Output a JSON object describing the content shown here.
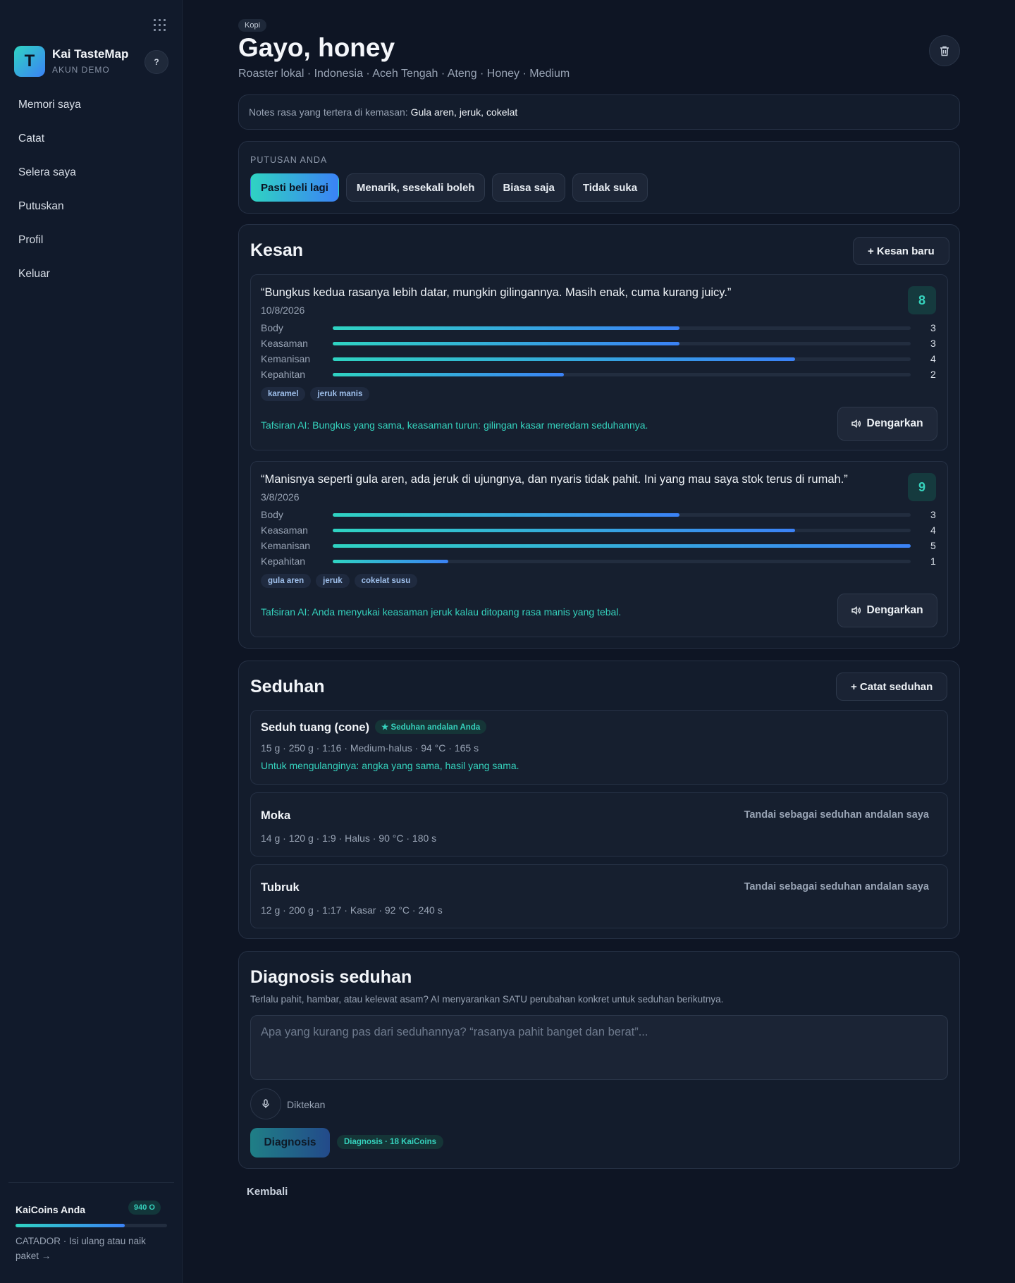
{
  "sidebar": {
    "brand_letter": "T",
    "brand_name": "Kai TasteMap",
    "brand_sub": "AKUN DEMO",
    "help_label": "?",
    "nav": [
      "Memori saya",
      "Catat",
      "Selera saya",
      "Putuskan",
      "Profil",
      "Keluar"
    ],
    "coins": {
      "title": "KaiCoins Anda",
      "badge": "940 O",
      "progress": 0.72,
      "note": "CATADOR · Isi ulang atau naik paket →"
    }
  },
  "header": {
    "chip": "Kopi",
    "title": "Gayo, honey",
    "meta": "Roaster lokal · Indonesia · Aceh Tengah · Ateng · Honey · Medium"
  },
  "notes": {
    "label": "Notes rasa yang tertera di kemasan:",
    "value": "Gula aren, jeruk, cokelat"
  },
  "decision": {
    "label": "PUTUSAN ANDA",
    "options": [
      "Pasti beli lagi",
      "Menarik, sesekali boleh",
      "Biasa saja",
      "Tidak suka"
    ],
    "selected": 0
  },
  "impressions": {
    "title": "Kesan",
    "add_label": "+ Kesan baru",
    "listen_label": "Dengarkan",
    "items": [
      {
        "quote": "“Bungkus kedua rasanya lebih datar, mungkin gilingannya. Masih enak, cuma kurang juicy.”",
        "date": "10/8/2026",
        "score": "8",
        "attributes": [
          {
            "label": "Body",
            "value": 3
          },
          {
            "label": "Keasaman",
            "value": 3
          },
          {
            "label": "Kemanisan",
            "value": 4
          },
          {
            "label": "Kepahitan",
            "value": 2
          }
        ],
        "tags": [
          "karamel",
          "jeruk manis"
        ],
        "ai": "Tafsiran AI: Bungkus yang sama, keasaman turun: gilingan kasar meredam seduhannya."
      },
      {
        "quote": "“Manisnya seperti gula aren, ada jeruk di ujungnya, dan nyaris tidak pahit. Ini yang mau saya stok terus di rumah.”",
        "date": "3/8/2026",
        "score": "9",
        "attributes": [
          {
            "label": "Body",
            "value": 3
          },
          {
            "label": "Keasaman",
            "value": 4
          },
          {
            "label": "Kemanisan",
            "value": 5
          },
          {
            "label": "Kepahitan",
            "value": 1
          }
        ],
        "tags": [
          "gula aren",
          "jeruk",
          "cokelat susu"
        ],
        "ai": "Tafsiran AI: Anda menyukai keasaman jeruk kalau ditopang rasa manis yang tebal."
      }
    ],
    "scale_max": 5
  },
  "brews": {
    "title": "Seduhan",
    "add_label": "+ Catat seduhan",
    "mark_label": "Tandai sebagai seduhan andalan saya",
    "items": [
      {
        "name": "Seduh tuang (cone)",
        "badge": "★ Seduhan andalan Anda",
        "params": "15 g · 250 g · 1:16 · Medium-halus · 94 °C · 165 s",
        "hint": "Untuk mengulanginya: angka yang sama, hasil yang sama."
      },
      {
        "name": "Moka",
        "params": "14 g · 120 g · 1:9 · Halus · 90 °C · 180 s"
      },
      {
        "name": "Tubruk",
        "params": "12 g · 200 g · 1:17 · Kasar · 92 °C · 240 s"
      }
    ]
  },
  "diagnosis": {
    "title": "Diagnosis seduhan",
    "desc": "Terlalu pahit, hambar, atau kelewat asam? AI menyarankan SATU perubahan konkret untuk seduhan berikutnya.",
    "placeholder": "Apa yang kurang pas dari seduhannya? “rasanya pahit banget dan berat”...",
    "dictate_label": "Diktekan",
    "button_label": "Diagnosis",
    "cost_label": "Diagnosis · 18 KaiCoins"
  },
  "back_label": "Kembali"
}
